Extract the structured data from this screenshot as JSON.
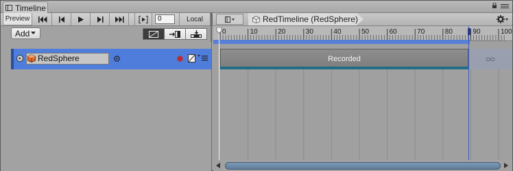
{
  "window": {
    "tab_title": "Timeline"
  },
  "toolbar": {
    "preview_label": "Preview",
    "frame_value": "0",
    "local_label": "Local"
  },
  "breadcrumb": {
    "label": "RedTimeline (RedSphere)"
  },
  "track_header": {
    "add_label": "Add"
  },
  "track": {
    "name": "RedSphere"
  },
  "ruler": {
    "ticks": [
      "0",
      "10",
      "20",
      "30",
      "40",
      "50",
      "60",
      "70",
      "80",
      "90",
      "100"
    ]
  },
  "clip": {
    "label": "Recorded"
  },
  "colors": {
    "track_selection": "#4f7ddb",
    "record_dot": "#b82d34",
    "clip_underline": "#1e6e8a",
    "end_marker": "#3a5ac8"
  },
  "icons": {
    "window": "timeline-window-icon",
    "lock": "lock-icon",
    "menu": "menu-icon",
    "start": "skip-to-start-icon",
    "prev": "previous-frame-icon",
    "play": "play-icon",
    "next": "next-frame-icon",
    "end": "skip-to-end-icon",
    "play_range": "play-range-icon",
    "gear": "gear-icon",
    "cube": "cube-icon"
  }
}
